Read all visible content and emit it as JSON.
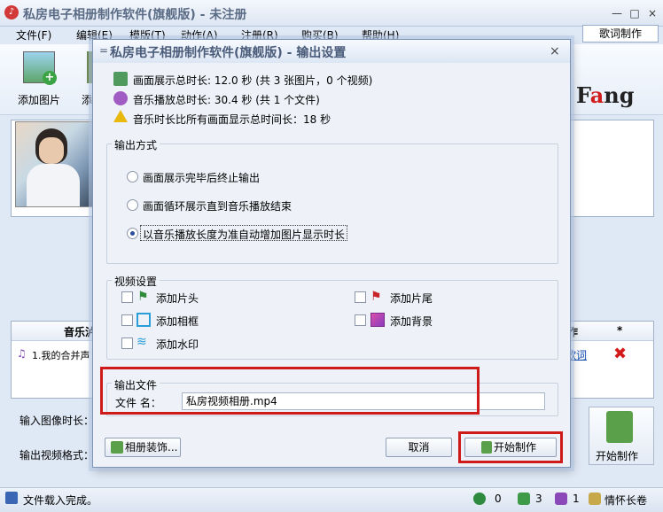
{
  "window": {
    "title": "私房电子相册制作软件(旗舰版) - 未注册",
    "app_icon_glyph": "♪"
  },
  "menu": {
    "items": [
      "文件(F)",
      "编辑(E)",
      "模版(T)",
      "动作(A)",
      "注册(R)",
      "购买(B)",
      "帮助(H)"
    ],
    "lyrics_button": "歌词制作"
  },
  "toolbar": {
    "add_image_label": "添加图片",
    "add_second_label_fragment": "添",
    "brand_prefix": "F",
    "brand_accent": "a",
    "brand_suffix": "ng"
  },
  "music_table": {
    "headers": [
      "音乐泸",
      "作",
      "*"
    ],
    "row_label": "1.我的合并声",
    "lyric_link": "歌词",
    "delete_glyph": "✖"
  },
  "bottom": {
    "input_duration_label": "输入图像时长：",
    "output_format_label": "输出视频格式：",
    "start_button": "开始制作"
  },
  "status": {
    "text": "文件载入完成。",
    "count_a": "0",
    "count_b": "3",
    "count_c": "1",
    "song": "情怀长卷"
  },
  "dialog": {
    "title": "私房电子相册制作软件(旗舰版) - 输出设置",
    "title_mark": "=",
    "close": "×",
    "info_lines": [
      "画面展示总时长: 12.0 秒 (共 3 张图片，0 个视频)",
      "音乐播放总时长: 30.4 秒 (共 1 个文件)",
      "音乐时长比所有画面显示总时间长：18 秒"
    ],
    "output_mode": {
      "title": "输出方式",
      "options": [
        "画面展示完毕后终止输出",
        "画面循环展示直到音乐播放结束",
        "以音乐播放长度为准自动增加图片显示时长"
      ],
      "selected_index": 2
    },
    "video_settings": {
      "title": "视频设置",
      "options": [
        "添加片头",
        "添加片尾",
        "添加相框",
        "添加背景",
        "添加水印"
      ]
    },
    "output_file": {
      "title": "输出文件",
      "filename_label": "文件 名：",
      "filename_value": "私房视频相册.mp4"
    },
    "buttons": {
      "decorate": "相册装饰...",
      "cancel": "取消",
      "start": "开始制作"
    },
    "highlight_color": "#cf1a1a"
  }
}
